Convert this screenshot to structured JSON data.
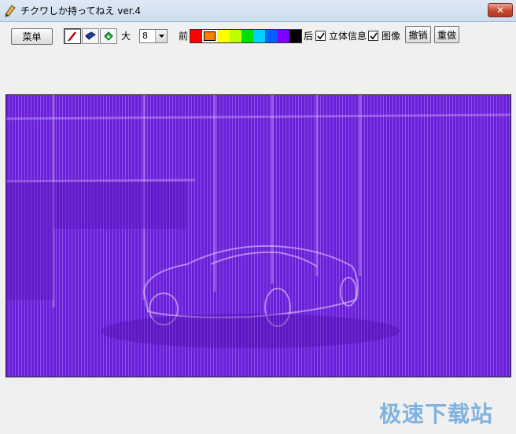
{
  "window": {
    "title": "チクワしか持ってねえ ver.4",
    "close_glyph": "✕"
  },
  "toolbar": {
    "menu_label": "菜单",
    "tools": [
      {
        "icon": "pencil-icon"
      },
      {
        "icon": "eraser-icon"
      },
      {
        "icon": "bucket-fill-icon"
      }
    ],
    "size_label": "大",
    "size_value": "8",
    "front_label": "前",
    "back_label": "后",
    "palette": [
      "#ff0000",
      "#ff8000",
      "#ffff00",
      "#c0ff00",
      "#00e000",
      "#00d0ff",
      "#0060ff",
      "#8000ff",
      "#000000"
    ],
    "selected_swatch": 1,
    "stereo_label": "立体信息",
    "stereo_checked": true,
    "image_label": "图像",
    "image_checked": true,
    "undo_label": "撤销",
    "redo_label": "重做"
  },
  "canvas": {
    "base_color": "#6a1fd8",
    "stripe_color": "#d2aaff"
  },
  "watermark": "极速下载站"
}
